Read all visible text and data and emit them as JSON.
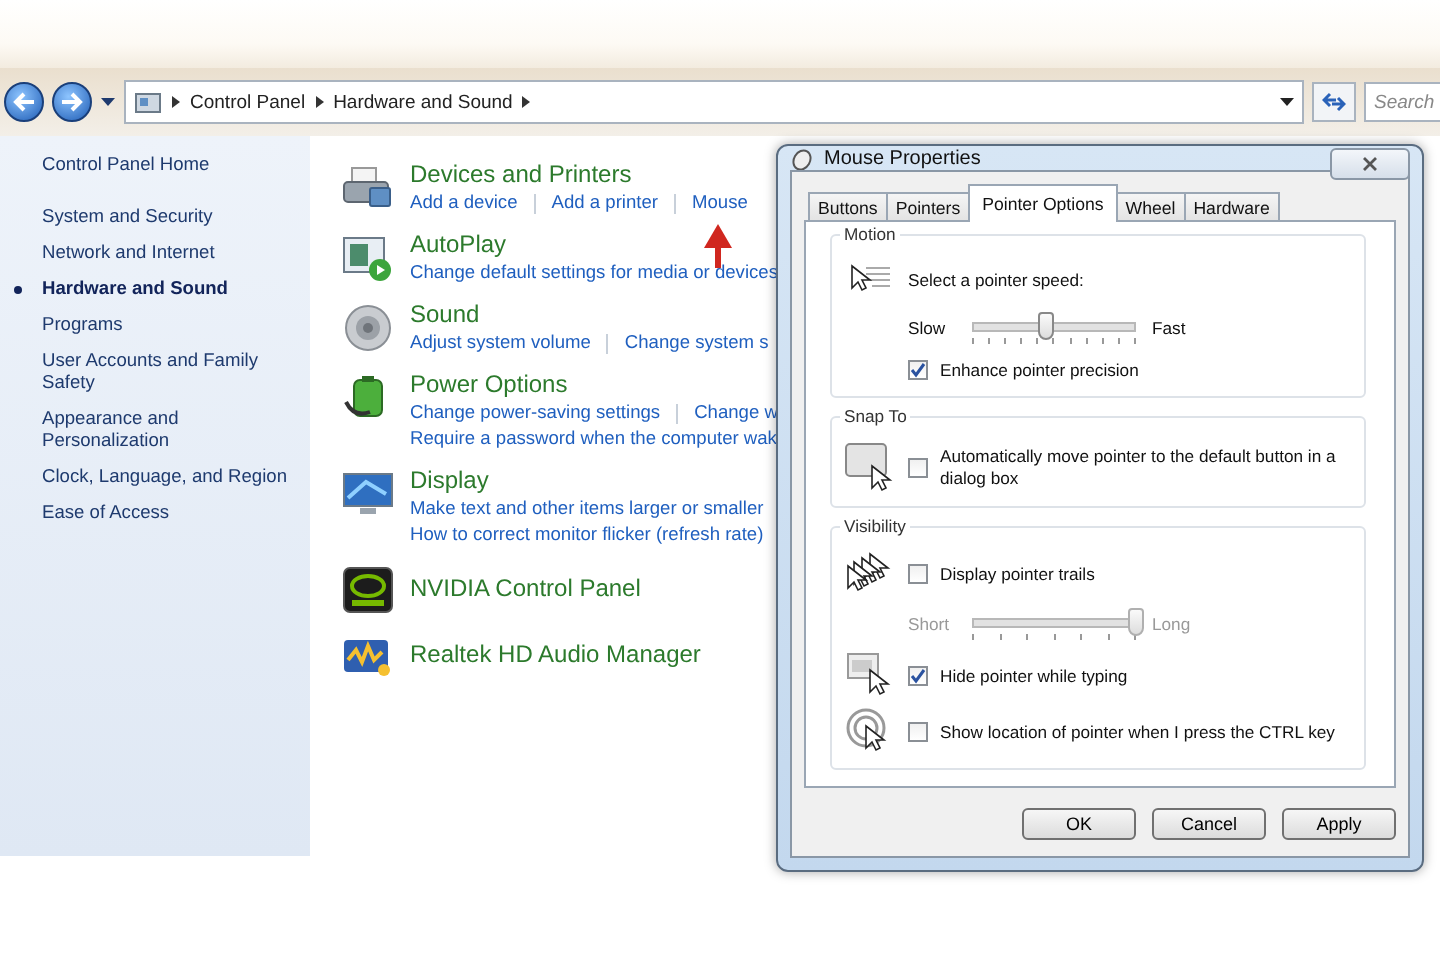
{
  "address_bar": {
    "breadcrumbs": [
      "Control Panel",
      "Hardware and Sound"
    ],
    "search": {
      "placeholder": "Search"
    }
  },
  "sidebar": {
    "items": [
      {
        "label": "Control Panel Home",
        "selected": false
      },
      {
        "label": "System and Security",
        "selected": false
      },
      {
        "label": "Network and Internet",
        "selected": false
      },
      {
        "label": "Hardware and Sound",
        "selected": true
      },
      {
        "label": "Programs",
        "selected": false
      },
      {
        "label": "User Accounts and Family Safety",
        "selected": false
      },
      {
        "label": "Appearance and Personalization",
        "selected": false
      },
      {
        "label": "Clock, Language, and Region",
        "selected": false
      },
      {
        "label": "Ease of Access",
        "selected": false
      }
    ]
  },
  "categories": [
    {
      "kind": "devices",
      "title": "Devices and Printers",
      "links": [
        [
          "Add a device",
          "Add a printer",
          "Mouse"
        ]
      ]
    },
    {
      "kind": "autoplay",
      "title": "AutoPlay",
      "links": [
        [
          "Change default settings for media or devices"
        ]
      ]
    },
    {
      "kind": "sound",
      "title": "Sound",
      "links": [
        [
          "Adjust system volume",
          "Change system s"
        ]
      ]
    },
    {
      "kind": "power",
      "title": "Power Options",
      "links": [
        [
          "Change power-saving settings",
          "Change w"
        ],
        [
          "Require a password when the computer wak"
        ]
      ]
    },
    {
      "kind": "display",
      "title": "Display",
      "links": [
        [
          "Make text and other items larger or smaller"
        ],
        [
          "How to correct monitor flicker (refresh rate)"
        ]
      ]
    },
    {
      "kind": "nvidia",
      "title": "NVIDIA Control Panel"
    },
    {
      "kind": "realtek",
      "title": "Realtek HD Audio Manager"
    }
  ],
  "dialog": {
    "title": "Mouse Properties",
    "tabs": [
      {
        "label": "Buttons",
        "selected": false
      },
      {
        "label": "Pointers",
        "selected": false
      },
      {
        "label": "Pointer Options",
        "selected": true
      },
      {
        "label": "Wheel",
        "selected": false
      },
      {
        "label": "Hardware",
        "selected": false
      }
    ],
    "groups": [
      {
        "title": "Motion",
        "items": [
          {
            "kind": "label",
            "text": "Select a pointer speed:"
          },
          {
            "kind": "slider",
            "min_label": "Slow",
            "max_label": "Fast",
            "level": 0.45,
            "disabled": false
          },
          {
            "kind": "checkbox",
            "label": "Enhance pointer precision",
            "checked": true
          }
        ]
      },
      {
        "title": "Snap To",
        "items": [
          {
            "kind": "checkbox",
            "label": "Automatically move pointer to the default button in a dialog box",
            "checked": false
          }
        ]
      },
      {
        "title": "Visibility",
        "items": [
          {
            "kind": "checkbox",
            "label": "Display pointer trails",
            "checked": false
          },
          {
            "kind": "slider",
            "min_label": "Short",
            "max_label": "Long",
            "level": 1,
            "disabled": true
          },
          {
            "kind": "checkbox",
            "label": "Hide pointer while typing",
            "checked": true
          },
          {
            "kind": "checkbox",
            "label": "Show location of pointer when I press the CTRL key",
            "checked": false
          }
        ]
      }
    ],
    "buttons": [
      "OK",
      "Cancel",
      "Apply"
    ]
  }
}
